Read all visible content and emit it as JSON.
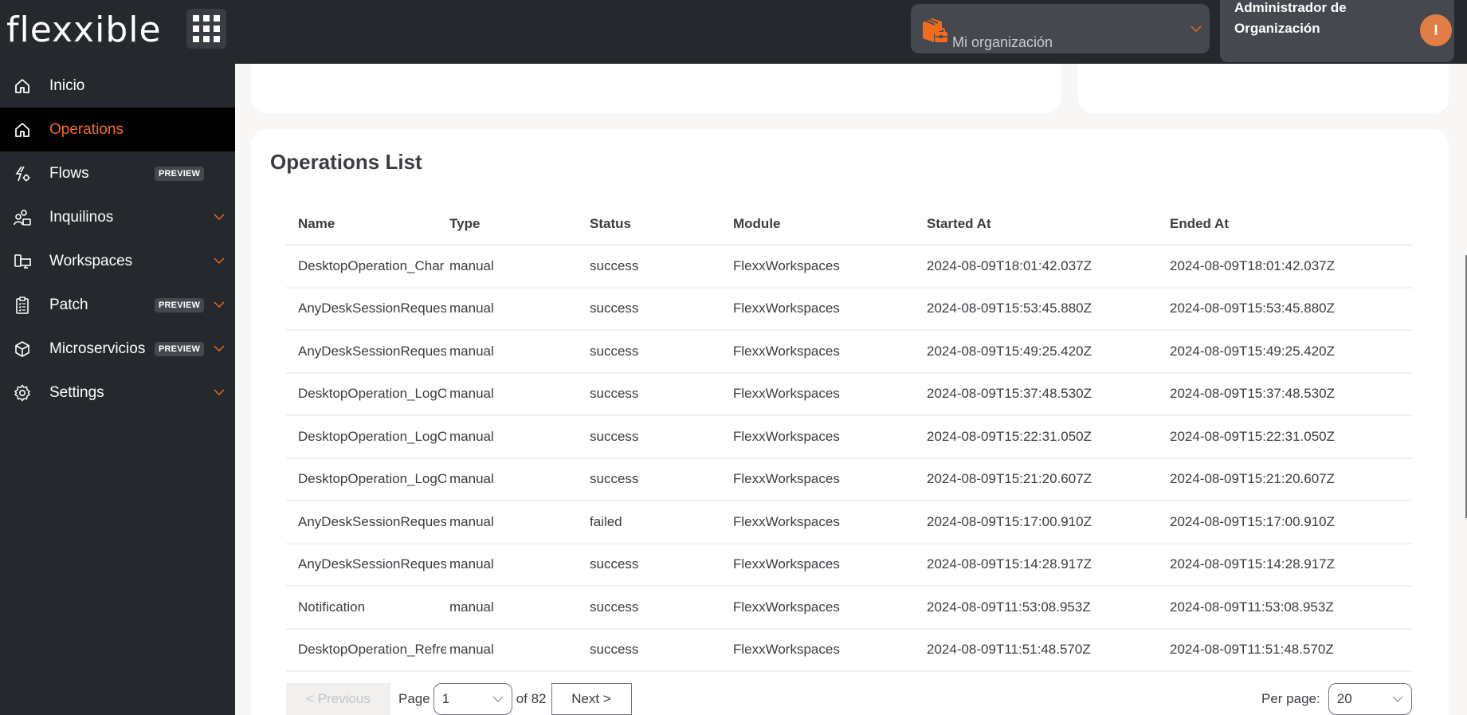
{
  "brand": {
    "logo_text": "flexxible",
    "accent": "#f26b1d"
  },
  "header": {
    "apps_menu_icon": "grid-icon",
    "organization": {
      "icon": "package-briefcase-icon",
      "label": "Mi organización"
    },
    "user": {
      "role": "Administrador de Organización",
      "avatar_initial": "I"
    }
  },
  "sidebar": {
    "items": [
      {
        "label": "Inicio",
        "icon": "home-icon",
        "active": false
      },
      {
        "label": "Operations",
        "icon": "home-icon",
        "active": true
      },
      {
        "label": "Flows",
        "icon": "flash-gear-icon",
        "badge": "PREVIEW"
      },
      {
        "label": "Inquilinos",
        "icon": "users-briefcase-icon",
        "expandable": true
      },
      {
        "label": "Workspaces",
        "icon": "devices-icon",
        "expandable": true
      },
      {
        "label": "Patch",
        "icon": "clipboard-checklist-icon",
        "badge": "PREVIEW",
        "expandable": true
      },
      {
        "label": "Microservicios",
        "icon": "cube-icon",
        "badge": "PREVIEW",
        "expandable": true
      },
      {
        "label": "Settings",
        "icon": "gear-icon",
        "expandable": true
      }
    ]
  },
  "main": {
    "title": "Operations List",
    "table": {
      "columns": [
        "Name",
        "Type",
        "Status",
        "Module",
        "Started At",
        "Ended At"
      ],
      "rows": [
        [
          "DesktopOperation_Char",
          "manual",
          "success",
          "FlexxWorkspaces",
          "2024-08-09T18:01:42.037Z",
          "2024-08-09T18:01:42.037Z"
        ],
        [
          "AnyDeskSessionReques",
          "manual",
          "success",
          "FlexxWorkspaces",
          "2024-08-09T15:53:45.880Z",
          "2024-08-09T15:53:45.880Z"
        ],
        [
          "AnyDeskSessionReques",
          "manual",
          "success",
          "FlexxWorkspaces",
          "2024-08-09T15:49:25.420Z",
          "2024-08-09T15:49:25.420Z"
        ],
        [
          "DesktopOperation_LogO",
          "manual",
          "success",
          "FlexxWorkspaces",
          "2024-08-09T15:37:48.530Z",
          "2024-08-09T15:37:48.530Z"
        ],
        [
          "DesktopOperation_LogO",
          "manual",
          "success",
          "FlexxWorkspaces",
          "2024-08-09T15:22:31.050Z",
          "2024-08-09T15:22:31.050Z"
        ],
        [
          "DesktopOperation_LogO",
          "manual",
          "success",
          "FlexxWorkspaces",
          "2024-08-09T15:21:20.607Z",
          "2024-08-09T15:21:20.607Z"
        ],
        [
          "AnyDeskSessionReques",
          "manual",
          "failed",
          "FlexxWorkspaces",
          "2024-08-09T15:17:00.910Z",
          "2024-08-09T15:17:00.910Z"
        ],
        [
          "AnyDeskSessionReques",
          "manual",
          "success",
          "FlexxWorkspaces",
          "2024-08-09T15:14:28.917Z",
          "2024-08-09T15:14:28.917Z"
        ],
        [
          "Notification",
          "manual",
          "success",
          "FlexxWorkspaces",
          "2024-08-09T11:53:08.953Z",
          "2024-08-09T11:53:08.953Z"
        ],
        [
          "DesktopOperation_Refre",
          "manual",
          "success",
          "FlexxWorkspaces",
          "2024-08-09T11:51:48.570Z",
          "2024-08-09T11:51:48.570Z"
        ]
      ]
    },
    "pagination": {
      "previous_label": "< Previous",
      "page_label": "Page",
      "current_page": "1",
      "of_label": "of 82",
      "next_label": "Next >",
      "per_page_label": "Per page:",
      "per_page_value": "20"
    }
  }
}
